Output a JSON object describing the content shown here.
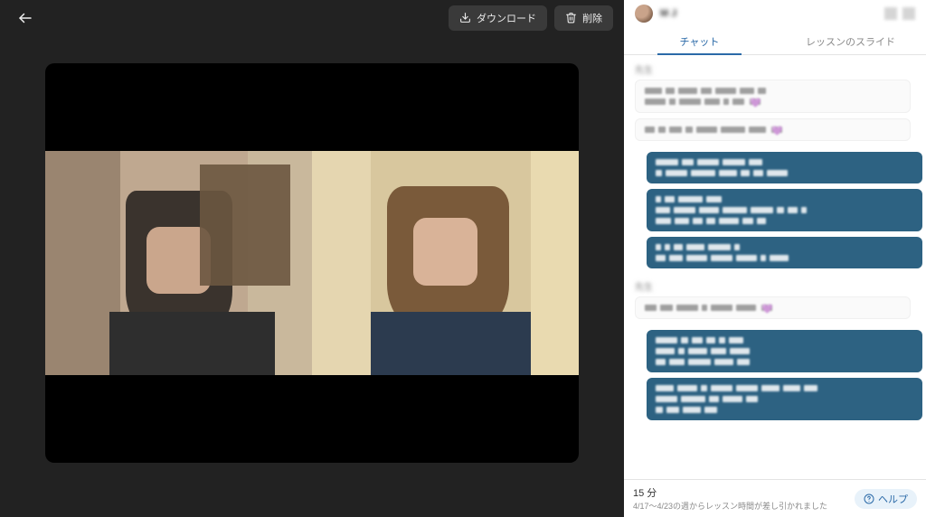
{
  "toolbar": {
    "download_label": "ダウンロード",
    "delete_label": "削除"
  },
  "header": {
    "user_name": "M J"
  },
  "tabs": {
    "chat_label": "チャット",
    "slides_label": "レッスンのスライド"
  },
  "chat": [
    {
      "side": "left",
      "sender": "先生",
      "bubbles": [
        {
          "tone": "white",
          "lines": 2,
          "heart": true
        },
        {
          "tone": "white",
          "lines": 1,
          "heart": true
        }
      ]
    },
    {
      "side": "right",
      "sender": "",
      "bubbles": [
        {
          "tone": "blue",
          "lines": 2
        },
        {
          "tone": "blue",
          "lines": 3
        },
        {
          "tone": "blue",
          "lines": 2
        }
      ]
    },
    {
      "side": "left",
      "sender": "先生",
      "bubbles": [
        {
          "tone": "white",
          "lines": 1,
          "heart": true
        }
      ]
    },
    {
      "side": "right",
      "sender": "",
      "bubbles": [
        {
          "tone": "blue",
          "lines": 3
        },
        {
          "tone": "blue",
          "lines": 3
        }
      ]
    }
  ],
  "footer": {
    "duration_label": "15 分",
    "note": "4/17〜4/23の週からレッスン時間が差し引かれました",
    "help_label": "ヘルプ"
  }
}
